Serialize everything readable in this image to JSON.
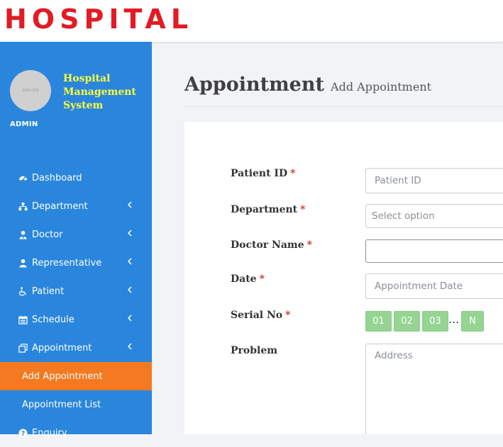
{
  "header": {
    "logo_text": "HOSPITAL"
  },
  "sidebar": {
    "avatar_text": "200×200",
    "brand": "Hospital Management System",
    "role": "ADMIN",
    "menu": [
      {
        "label": "Dashboard",
        "icon": "dashboard-icon",
        "has_children": false
      },
      {
        "label": "Department",
        "icon": "sitemap-icon",
        "has_children": true
      },
      {
        "label": "Doctor",
        "icon": "user-md-icon",
        "has_children": true
      },
      {
        "label": "Representative",
        "icon": "user-icon",
        "has_children": true
      },
      {
        "label": "Patient",
        "icon": "wheelchair-icon",
        "has_children": true
      },
      {
        "label": "Schedule",
        "icon": "calendar-icon",
        "has_children": true
      },
      {
        "label": "Appointment",
        "icon": "appointment-icon",
        "has_children": true
      }
    ],
    "submenu": [
      {
        "label": "Add Appointment",
        "active": true
      },
      {
        "label": "Appointment List",
        "active": false
      }
    ],
    "last_item": {
      "label": "Enquiry",
      "icon": "question-icon"
    }
  },
  "page": {
    "title": "Appointment",
    "subtitle": "Add Appointment"
  },
  "form": {
    "patient_id": {
      "label": "Patient ID",
      "placeholder": "Patient ID",
      "required": "*"
    },
    "department": {
      "label": "Department",
      "placeholder": "Select option",
      "required": "*"
    },
    "doctor_name": {
      "label": "Doctor Name",
      "value": "",
      "required": "*"
    },
    "date": {
      "label": "Date",
      "placeholder": "Appointment Date",
      "required": "*"
    },
    "serial_no": {
      "label": "Serial No",
      "required": "*",
      "slots": [
        "01",
        "02",
        "03"
      ],
      "ellipsis": "...",
      "last": "N"
    },
    "problem": {
      "label": "Problem",
      "placeholder": "Address"
    }
  },
  "colors": {
    "sidebar": "#2a86dd",
    "active": "#f47920",
    "brand": "#ffff3a",
    "logo": "#e21b24",
    "serial": "#95d493"
  }
}
